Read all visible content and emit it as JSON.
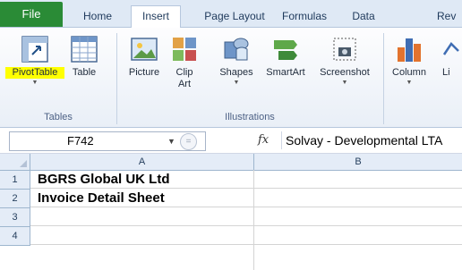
{
  "tabs": [
    "File",
    "Home",
    "Insert",
    "Page Layout",
    "Formulas",
    "Data",
    "Rev"
  ],
  "active_tab": "Insert",
  "ribbon": {
    "tables_group": {
      "label": "Tables",
      "pivot": "PivotTable",
      "table": "Table"
    },
    "illustrations_group": {
      "label": "Illustrations",
      "picture": "Picture",
      "clip_art_line1": "Clip",
      "clip_art_line2": "Art",
      "shapes": "Shapes",
      "smartart": "SmartArt",
      "screenshot": "Screenshot"
    },
    "charts_group": {
      "column": "Column",
      "line": "Li"
    }
  },
  "formula_bar": {
    "name_box": "F742",
    "fx": "fx",
    "content": "Solvay - Developmental LTA"
  },
  "columns": [
    "A",
    "B"
  ],
  "rows": [
    {
      "num": "1",
      "a": "BGRS Global UK Ltd"
    },
    {
      "num": "2",
      "a": "Invoice Detail Sheet"
    },
    {
      "num": "3",
      "a": ""
    },
    {
      "num": "4",
      "a": ""
    }
  ],
  "colors": {
    "file_tab": "#2a8b36",
    "highlight": "#ffff00",
    "header_bg": "#e4ecf7"
  }
}
